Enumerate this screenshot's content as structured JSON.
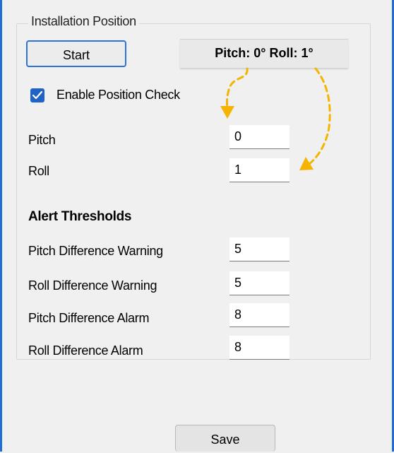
{
  "group": {
    "title": "Installation Position"
  },
  "start_button": {
    "label": "Start"
  },
  "readout": {
    "text": "Pitch: 0° Roll: 1°"
  },
  "enable_check": {
    "label": "Enable Position Check",
    "checked": true,
    "color": "#1f63c6"
  },
  "position": {
    "pitch": {
      "label": "Pitch",
      "value": "0"
    },
    "roll": {
      "label": "Roll",
      "value": "1"
    }
  },
  "alerts": {
    "heading": "Alert Thresholds",
    "rows": [
      {
        "label": "Pitch Difference Warning",
        "value": "5"
      },
      {
        "label": "Roll Difference Warning",
        "value": "5"
      },
      {
        "label": "Pitch Difference Alarm",
        "value": "8"
      },
      {
        "label": "Roll Difference Alarm",
        "value": "8"
      }
    ]
  },
  "save_button": {
    "label": "Save"
  },
  "colors": {
    "accent": "#1f6fd1",
    "annotation_arrow": "#f5b400"
  }
}
